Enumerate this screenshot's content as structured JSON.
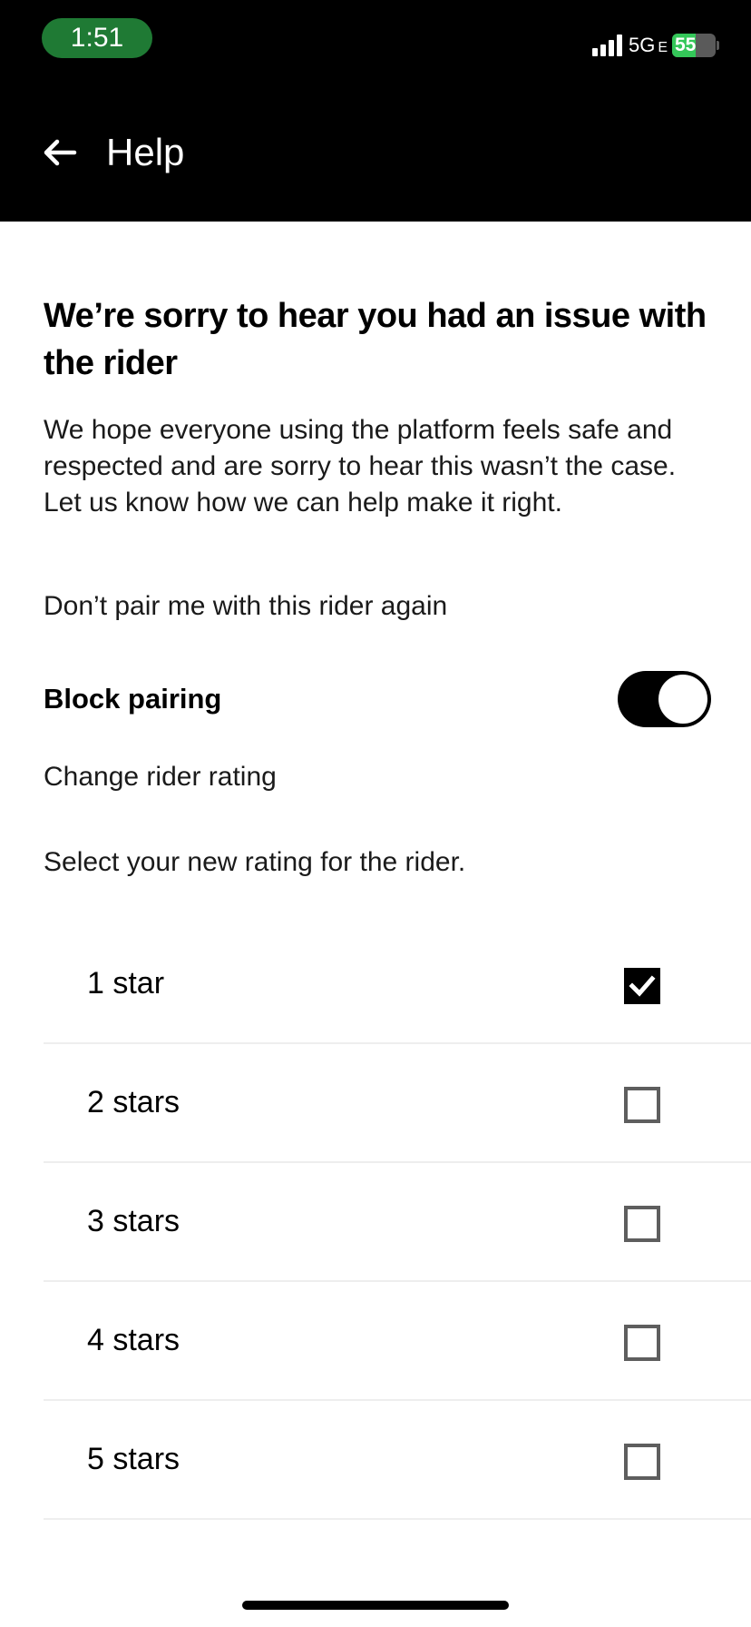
{
  "status_bar": {
    "time": "1:51",
    "network": "5G",
    "network_suffix": "E",
    "battery_percent": "55",
    "battery_level": 0.55,
    "signal_bars": 4
  },
  "header": {
    "title": "Help",
    "back_icon": "arrow-left-icon"
  },
  "main": {
    "headline": "We’re sorry to hear you had an issue with the rider",
    "body": "We hope everyone using the platform feels safe and respected and are sorry to hear this wasn’t the case. Let us know how we can help make it right.",
    "block_prompt": "Don’t pair me with this rider again",
    "block_label": "Block pairing",
    "block_enabled": true,
    "rating_label": "Change rider rating",
    "rating_prompt": "Select your new rating for the rider.",
    "rating_options": [
      {
        "label": "1 star",
        "checked": true
      },
      {
        "label": "2 stars",
        "checked": false
      },
      {
        "label": "3 stars",
        "checked": false
      },
      {
        "label": "4 stars",
        "checked": false
      },
      {
        "label": "5 stars",
        "checked": false
      }
    ]
  },
  "colors": {
    "header_bg": "#000000",
    "time_pill": "#1f7a34",
    "battery_fill": "#34c759",
    "toggle_on": "#000000",
    "divider": "#eeeeee"
  }
}
